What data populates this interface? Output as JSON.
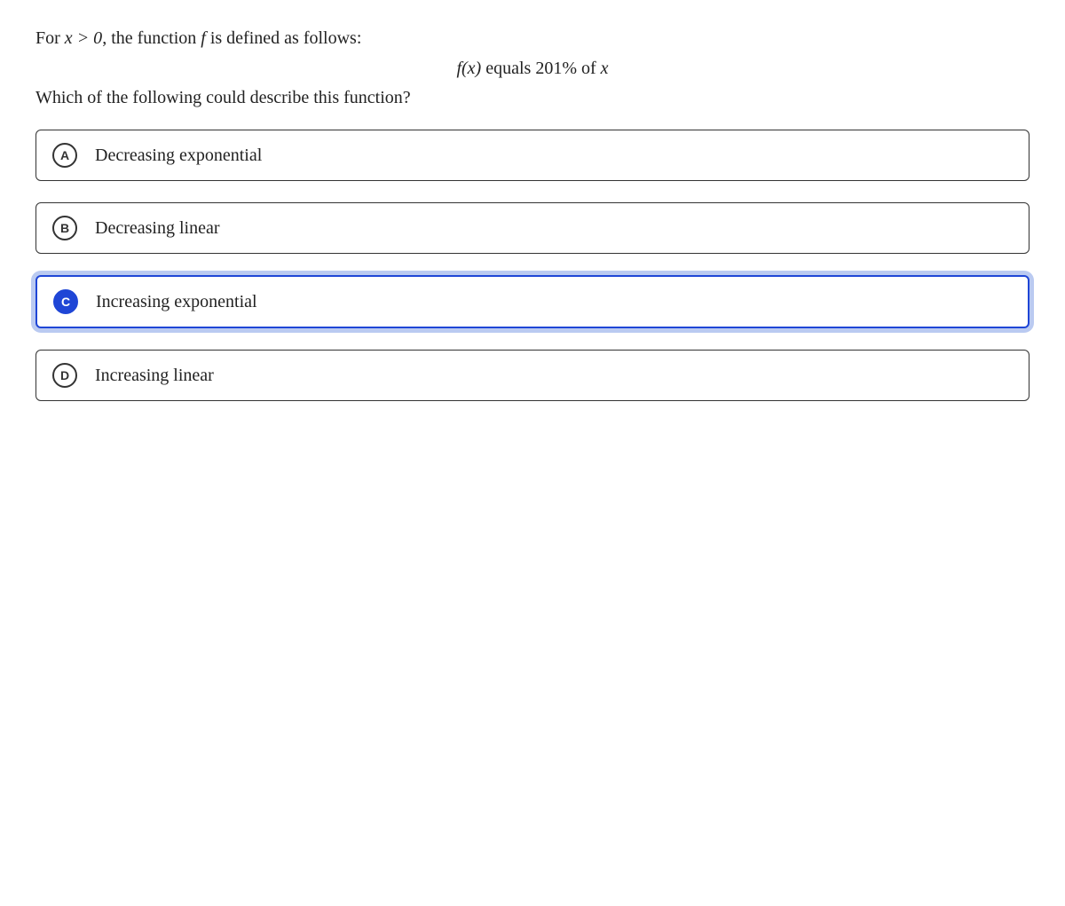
{
  "question": {
    "stem_prefix": "For ",
    "stem_cond": "x > 0",
    "stem_mid": ", the function ",
    "stem_fn": "f",
    "stem_suffix": " is defined as follows:",
    "equation_lhs": "f(x)",
    "equation_mid": " equals ",
    "equation_pct": "201%",
    "equation_suffix": " of ",
    "equation_var": "x",
    "prompt": "Which of the following could describe this function?"
  },
  "choices": [
    {
      "letter": "A",
      "text": "Decreasing exponential",
      "selected": false
    },
    {
      "letter": "B",
      "text": "Decreasing linear",
      "selected": false
    },
    {
      "letter": "C",
      "text": "Increasing exponential",
      "selected": true
    },
    {
      "letter": "D",
      "text": "Increasing linear",
      "selected": false
    }
  ]
}
